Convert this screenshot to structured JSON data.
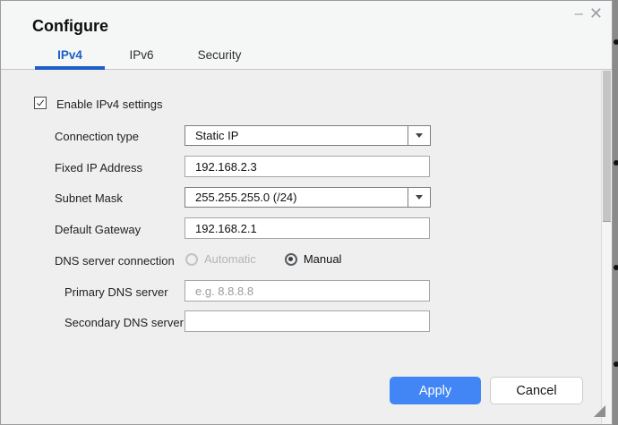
{
  "window": {
    "title": "Configure",
    "minimize_icon": "–",
    "close_icon": "✕"
  },
  "tabs": [
    {
      "label": "IPv4",
      "active": true
    },
    {
      "label": "IPv6",
      "active": false
    },
    {
      "label": "Security",
      "active": false
    }
  ],
  "form": {
    "enable_checkbox": {
      "label": "Enable IPv4 settings",
      "checked": true
    },
    "connection_type": {
      "label": "Connection type",
      "value": "Static IP"
    },
    "fixed_ip": {
      "label": "Fixed IP Address",
      "value": "192.168.2.3"
    },
    "subnet_mask": {
      "label": "Subnet Mask",
      "value": "255.255.255.0 (/24)"
    },
    "default_gateway": {
      "label": "Default Gateway",
      "value": "192.168.2.1"
    },
    "dns_connection": {
      "label": "DNS server connection",
      "options": [
        {
          "label": "Automatic",
          "selected": false,
          "disabled": true
        },
        {
          "label": "Manual",
          "selected": true,
          "disabled": false
        }
      ]
    },
    "primary_dns": {
      "label": "Primary DNS server",
      "value": "",
      "placeholder": "e.g. 8.8.8.8"
    },
    "secondary_dns": {
      "label": "Secondary DNS server",
      "value": "",
      "placeholder": ""
    }
  },
  "footer": {
    "apply_label": "Apply",
    "cancel_label": "Cancel"
  },
  "colors": {
    "active_tab_blue": "#1d5dc9",
    "apply_button_blue": "#4286f5",
    "dialog_header_bg": "#f5f6f6",
    "dialog_body_bg": "#efefef",
    "backdrop_gray": "#8a8a8a"
  }
}
